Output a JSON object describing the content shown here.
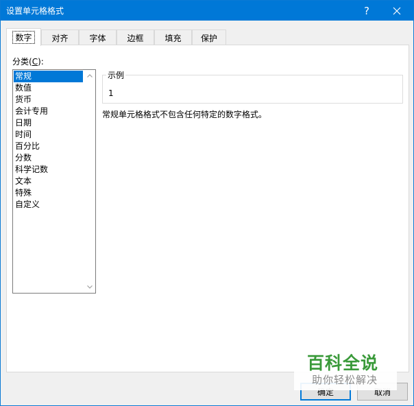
{
  "window": {
    "title": "设置单元格格式",
    "help_symbol": "?",
    "accent_color": "#0078d7"
  },
  "tabs": [
    {
      "label": "数字",
      "active": true
    },
    {
      "label": "对齐",
      "active": false
    },
    {
      "label": "字体",
      "active": false
    },
    {
      "label": "边框",
      "active": false
    },
    {
      "label": "填充",
      "active": false
    },
    {
      "label": "保护",
      "active": false
    }
  ],
  "category": {
    "label_prefix": "分类(",
    "label_key": "C",
    "label_suffix": "):",
    "items": [
      "常规",
      "数值",
      "货币",
      "会计专用",
      "日期",
      "时间",
      "百分比",
      "分数",
      "科学记数",
      "文本",
      "特殊",
      "自定义"
    ],
    "selected": "常规"
  },
  "sample": {
    "legend": "示例",
    "value": "1"
  },
  "description": "常规单元格格式不包含任何特定的数字格式。",
  "buttons": {
    "ok": "确定",
    "cancel": "取消"
  },
  "watermark": {
    "main": "百科全说",
    "sub": "助你轻松解决"
  }
}
